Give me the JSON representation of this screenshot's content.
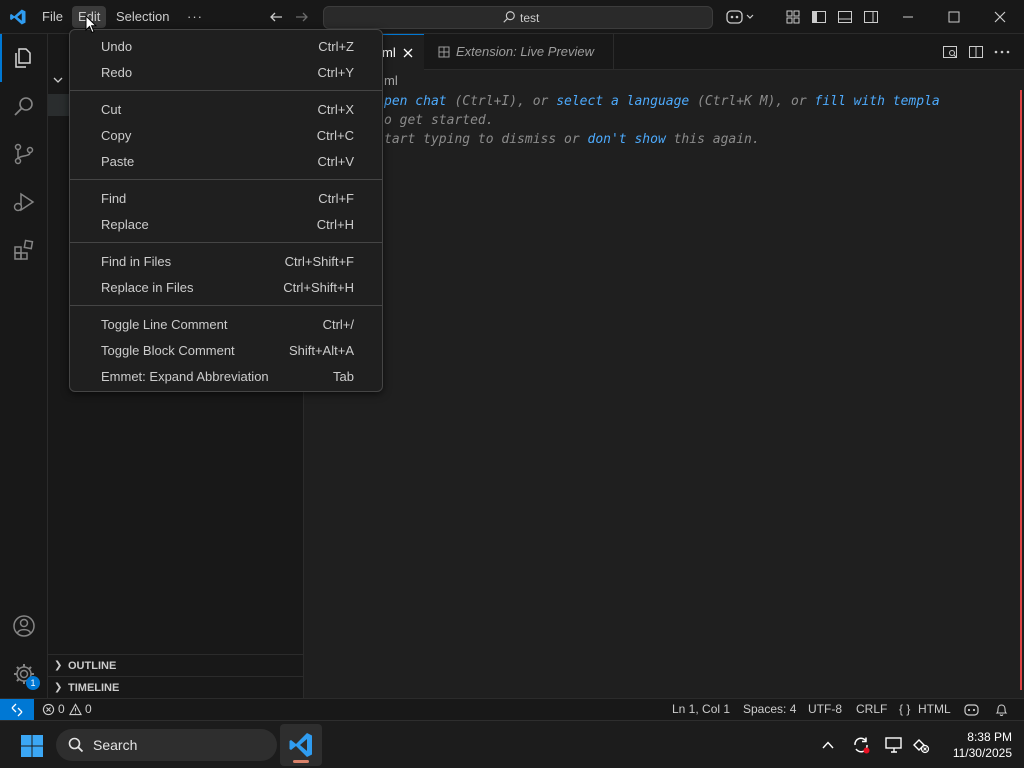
{
  "titlebar": {
    "menus": {
      "file": "File",
      "edit": "Edit",
      "selection": "Selection",
      "more": "···"
    },
    "search_text": "test"
  },
  "tabs": {
    "active": "ml",
    "preview": "Extension: Live Preview"
  },
  "editor": {
    "breadcrumb": "ml",
    "hint_line1": {
      "lead": "pen chat",
      "t1": " (Ctrl+I), or ",
      "l2": "select a language",
      "t2": " (Ctrl+K M), or ",
      "l3": "fill with templa"
    },
    "hint_line2": "o get started.",
    "hint_line3": {
      "t1": "tart typing to dismiss or ",
      "l1": "don't show",
      "t2": " this again."
    }
  },
  "edit_menu": {
    "items": [
      {
        "label": "Undo",
        "shortcut": "Ctrl+Z"
      },
      {
        "label": "Redo",
        "shortcut": "Ctrl+Y"
      },
      {
        "label": "Cut",
        "shortcut": "Ctrl+X"
      },
      {
        "label": "Copy",
        "shortcut": "Ctrl+C"
      },
      {
        "label": "Paste",
        "shortcut": "Ctrl+V"
      },
      {
        "label": "Find",
        "shortcut": "Ctrl+F"
      },
      {
        "label": "Replace",
        "shortcut": "Ctrl+H"
      },
      {
        "label": "Find in Files",
        "shortcut": "Ctrl+Shift+F"
      },
      {
        "label": "Replace in Files",
        "shortcut": "Ctrl+Shift+H"
      },
      {
        "label": "Toggle Line Comment",
        "shortcut": "Ctrl+/"
      },
      {
        "label": "Toggle Block Comment",
        "shortcut": "Shift+Alt+A"
      },
      {
        "label": "Emmet: Expand Abbreviation",
        "shortcut": "Tab"
      }
    ]
  },
  "sidebar": {
    "outline": "OUTLINE",
    "timeline": "TIMELINE"
  },
  "activity": {
    "accounts_badge": "1"
  },
  "statusbar": {
    "errors": "0",
    "warnings": "0",
    "position": "Ln 1, Col 1",
    "spaces": "Spaces: 4",
    "encoding": "UTF-8",
    "eol": "CRLF",
    "language": "HTML"
  },
  "taskbar": {
    "search_label": "Search",
    "time": "8:38 PM",
    "date": "11/30/2025"
  },
  "colors": {
    "accent": "#0078d4",
    "link": "#4daafc",
    "background": "#1f1f1f"
  }
}
